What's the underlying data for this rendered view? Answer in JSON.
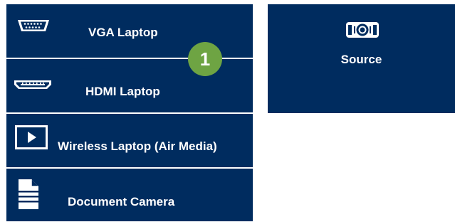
{
  "colors": {
    "panel_bg": "#002c5f",
    "badge_bg": "#6ea443",
    "text": "#ffffff"
  },
  "sources": [
    {
      "label": "VGA Laptop",
      "icon": "vga-port-icon"
    },
    {
      "label": "HDMI Laptop",
      "icon": "hdmi-port-icon"
    },
    {
      "label": "Wireless Laptop (Air Media)",
      "icon": "play-screen-icon"
    },
    {
      "label": "Document Camera",
      "icon": "document-icon"
    }
  ],
  "badge": {
    "number": "1"
  },
  "source_panel": {
    "label": "Source",
    "icon": "projector-icon"
  }
}
